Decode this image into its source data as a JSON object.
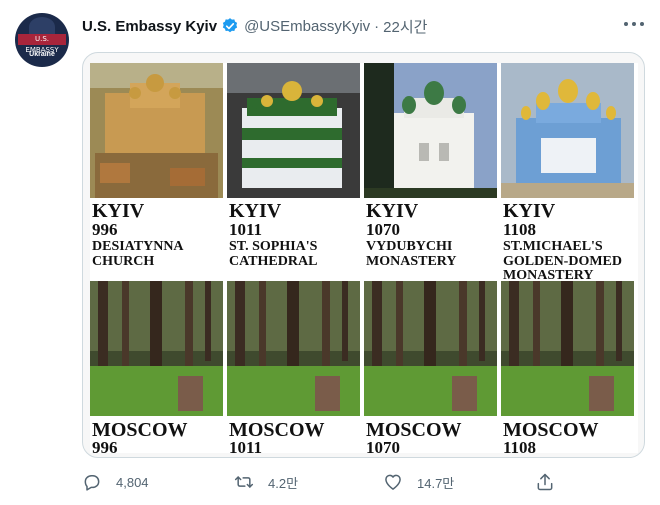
{
  "account": {
    "avatar_banner": "U.S. EMBASSY",
    "avatar_label": "Ukraine",
    "display_name": "U.S. Embassy Kyiv",
    "handle": "@USEmbassyKyiv",
    "separator": "·",
    "time": "22시간"
  },
  "grid": {
    "kyiv": [
      {
        "city": "KYIV",
        "year": "996",
        "name": "DESIATYNNA CHURCH"
      },
      {
        "city": "KYIV",
        "year": "1011",
        "name": "ST. SOPHIA'S CATHEDRAL"
      },
      {
        "city": "KYIV",
        "year": "1070",
        "name": "VYDUBYCHI MONASTERY"
      },
      {
        "city": "KYIV",
        "year": "1108",
        "name": "ST.MICHAEL'S GOLDEN-DOMED MONASTERY"
      }
    ],
    "moscow": [
      {
        "city": "MOSCOW",
        "year": "996"
      },
      {
        "city": "MOSCOW",
        "year": "1011"
      },
      {
        "city": "MOSCOW",
        "year": "1070"
      },
      {
        "city": "MOSCOW",
        "year": "1108"
      }
    ]
  },
  "actions": {
    "reply_count": "4,804",
    "retweet_count": "4.2만",
    "like_count": "14.7만"
  },
  "colors": {
    "secondary_text": "#536471",
    "verified_blue": "#1d9bf0",
    "border": "#cfd9de"
  },
  "icons": {
    "verified": "verified-badge-icon",
    "more": "more-options-icon",
    "reply": "reply-icon",
    "retweet": "retweet-icon",
    "like": "like-icon",
    "share": "share-icon"
  }
}
